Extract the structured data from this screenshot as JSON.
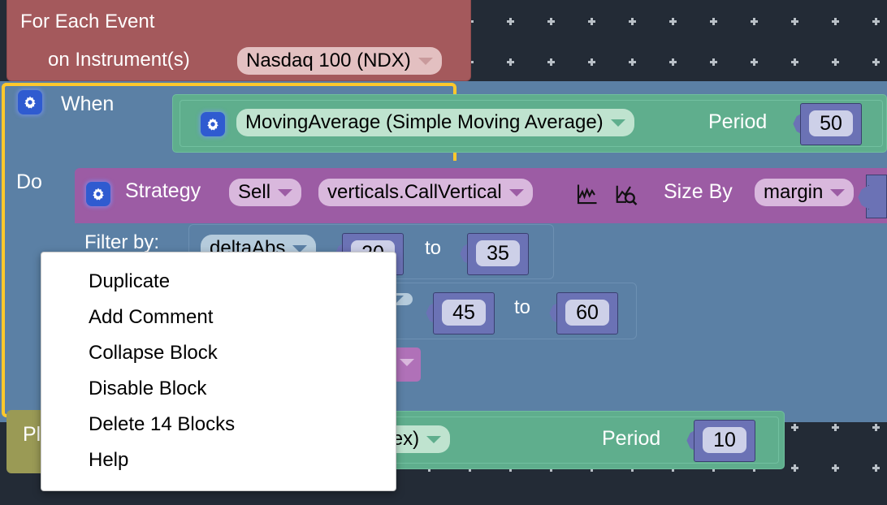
{
  "app": {
    "kind": "visual-block-strategy-editor",
    "canvas_background": "#232b36",
    "grid_dot_color": "#b9c0c7"
  },
  "blocks": {
    "for_each_event": {
      "color": "#a4595c",
      "title": "For Each Event",
      "instrument_label": "on Instrument(s)",
      "instrument_value": "Nasdaq 100 (NDX)"
    },
    "when": {
      "color": "#5b80a5",
      "selected": true,
      "selection_color": "#ffc82c",
      "label": "When",
      "do_label": "Do",
      "gear_icon": "gear-icon"
    },
    "moving_average": {
      "color": "#5fae8d",
      "gear_icon": "gear-icon",
      "indicator": "MovingAverage (Simple Moving Average)",
      "period_label": "Period",
      "period_value": "50"
    },
    "strategy": {
      "color": "#9c5ca4",
      "gear_icon": "gear-icon",
      "label": "Strategy",
      "side": "Sell",
      "template": "verticals.CallVertical",
      "chart_icon": "line-chart-icon",
      "inspect_icon": "chart-search-icon",
      "size_by_label": "Size By",
      "size_by_value": "margin"
    },
    "filter": {
      "label": "Filter by:",
      "rows": [
        {
          "field": "deltaAbs",
          "from": "20",
          "to_label": "to",
          "to": "35"
        },
        {
          "field": "",
          "from": "45",
          "to_label": "to",
          "to": "60"
        }
      ]
    },
    "plot": {
      "color": "#9a9a55",
      "label": "Plot"
    },
    "rsi": {
      "color": "#5fae8d",
      "indicator": "RSI (Relative Strength Index)",
      "indicator_visible_fragment": "e Strength Index)",
      "period_label": "Period",
      "period_value": "10"
    }
  },
  "context_menu": {
    "items": [
      {
        "label": "Duplicate"
      },
      {
        "label": "Add Comment"
      },
      {
        "label": "Collapse Block"
      },
      {
        "label": "Disable Block"
      },
      {
        "label": "Delete 14 Blocks"
      },
      {
        "label": "Help"
      }
    ]
  }
}
